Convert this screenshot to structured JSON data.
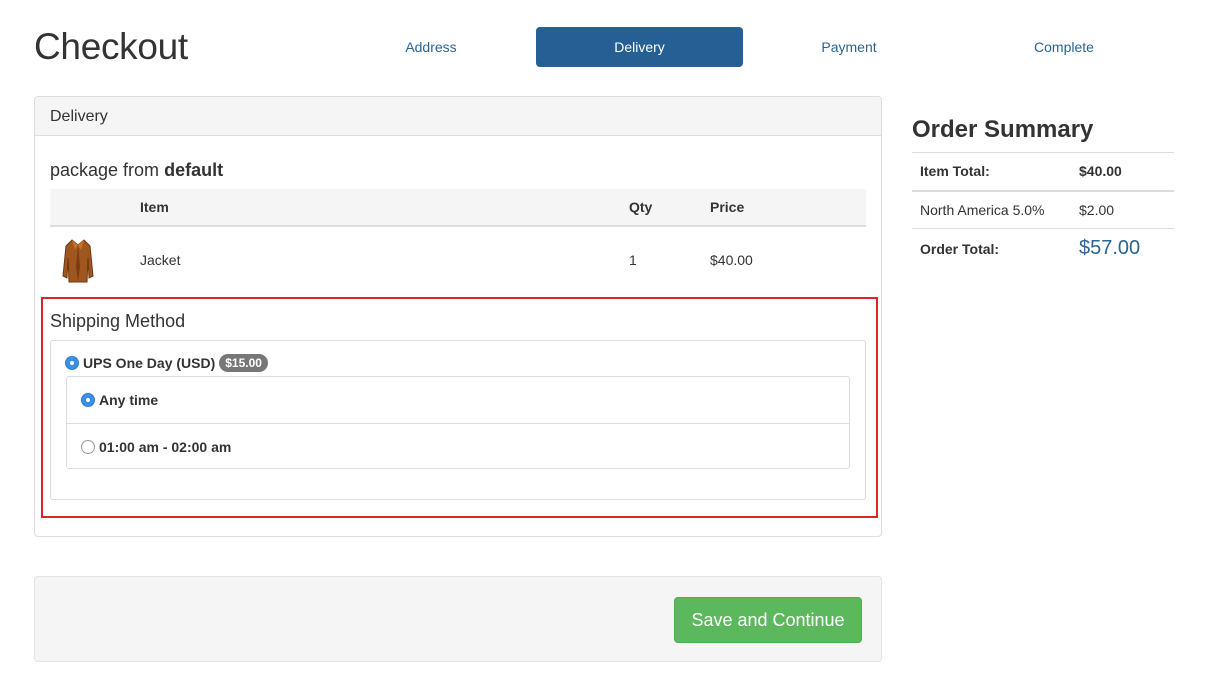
{
  "page": {
    "title": "Checkout"
  },
  "steps": [
    {
      "label": "Address",
      "active": false
    },
    {
      "label": "Delivery",
      "active": true
    },
    {
      "label": "Payment",
      "active": false
    },
    {
      "label": "Complete",
      "active": false
    }
  ],
  "delivery": {
    "heading": "Delivery",
    "package_prefix": "package from",
    "package_source": "default",
    "table": {
      "headers": {
        "item": "Item",
        "qty": "Qty",
        "price": "Price"
      },
      "rows": [
        {
          "name": "Jacket",
          "qty": "1",
          "price": "$40.00"
        }
      ]
    },
    "shipping": {
      "title": "Shipping Method",
      "method_label": "UPS One Day (USD)",
      "method_price": "$15.00",
      "slots": [
        {
          "label": "Any time",
          "selected": true
        },
        {
          "label": "01:00 am - 02:00 am",
          "selected": false
        }
      ]
    }
  },
  "summary": {
    "title": "Order Summary",
    "item_total_label": "Item Total:",
    "item_total_value": "$40.00",
    "tax_label": "North America 5.0%",
    "tax_value": "$2.00",
    "order_total_label": "Order Total:",
    "order_total_value": "$57.00"
  },
  "actions": {
    "save_label": "Save and Continue"
  },
  "colors": {
    "accent": "#255f94",
    "link": "#2a6496",
    "success": "#5cb85c",
    "highlight": "#d9262b"
  }
}
